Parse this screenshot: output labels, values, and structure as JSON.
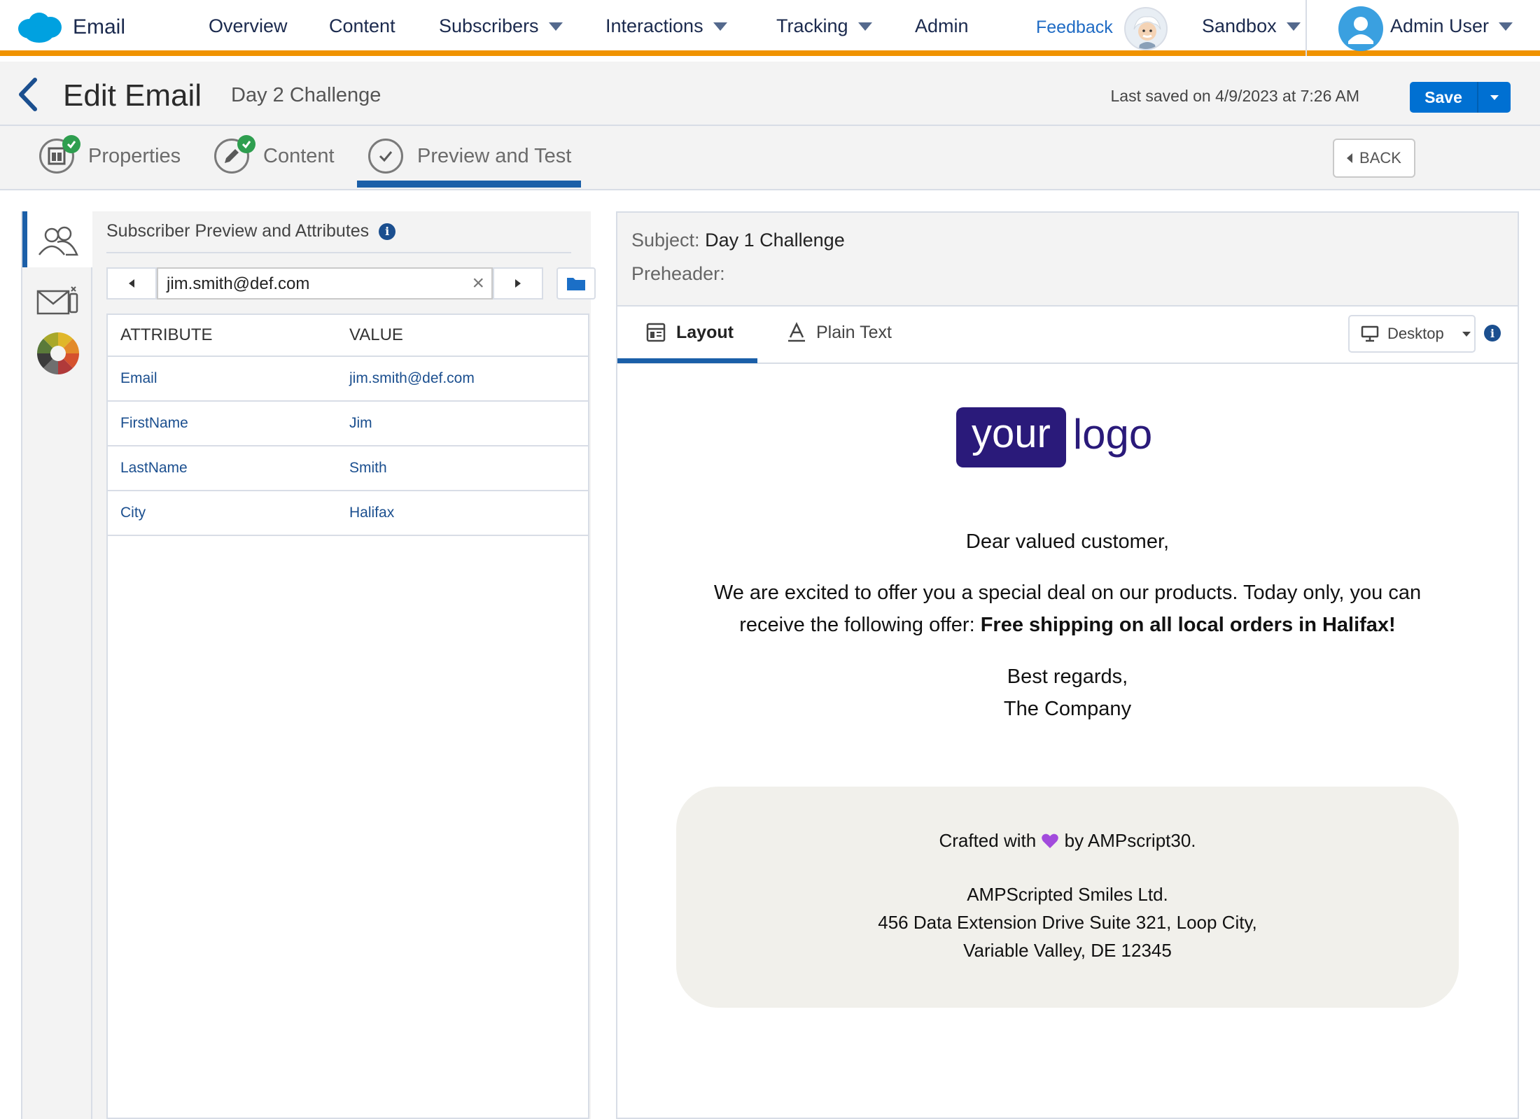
{
  "app": {
    "name": "Email"
  },
  "nav": {
    "items": [
      "Overview",
      "Content",
      "Subscribers",
      "Interactions",
      "Tracking",
      "Admin"
    ],
    "feedback": "Feedback",
    "business_unit": "Sandbox",
    "user": "Admin User"
  },
  "header": {
    "title": "Edit Email",
    "email_name": "Day 2 Challenge",
    "last_saved": "Last saved on 4/9/2023 at 7:26 AM",
    "save_label": "Save"
  },
  "steps": {
    "items": [
      {
        "label": "Properties",
        "complete": true
      },
      {
        "label": "Content",
        "complete": true
      },
      {
        "label": "Preview and Test",
        "complete": false,
        "active": true
      }
    ],
    "back_label": "BACK"
  },
  "subscriber_panel": {
    "title": "Subscriber Preview and Attributes",
    "selected_subscriber": "jim.smith@def.com",
    "columns": [
      "ATTRIBUTE",
      "VALUE"
    ],
    "rows": [
      {
        "attribute": "Email",
        "value": "jim.smith@def.com"
      },
      {
        "attribute": "FirstName",
        "value": "Jim"
      },
      {
        "attribute": "LastName",
        "value": "Smith"
      },
      {
        "attribute": "City",
        "value": "Halifax"
      }
    ]
  },
  "preview": {
    "subject_label": "Subject:",
    "subject": "Day 1 Challenge",
    "preheader_label": "Preheader:",
    "preheader": "",
    "tabs": [
      "Layout",
      "Plain Text"
    ],
    "active_tab": "Layout",
    "device": "Desktop"
  },
  "email": {
    "logo_left": "your",
    "logo_right": "logo",
    "greeting": "Dear valued customer,",
    "offer_intro": "We are excited to offer you a special deal on our products. Today only, you can receive the following offer:",
    "offer_bold": "Free shipping on all local orders in Halifax!",
    "regards": "Best regards,",
    "signature": "The Company",
    "footer": {
      "crafted_before": "Crafted with",
      "crafted_after": "by AMPscript30.",
      "company": "AMPScripted Smiles Ltd.",
      "address_line1": "456 Data Extension Drive Suite 321, Loop City,",
      "address_line2": "Variable Valley, DE 12345"
    }
  },
  "colors": {
    "brand_orange": "#f09300",
    "primary_blue": "#0070d2",
    "logo_purple": "#2a1a7a",
    "success_green": "#2e9e4f"
  }
}
